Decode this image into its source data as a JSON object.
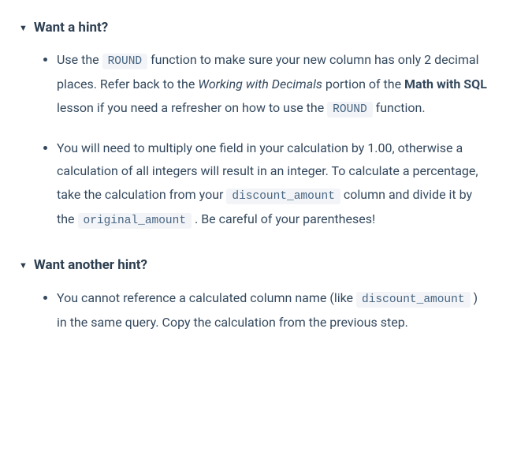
{
  "hint1": {
    "title": "Want a hint?",
    "bullet1": {
      "t1": "Use the ",
      "code1": "ROUND",
      "t2": " function to make sure your new column has only 2 decimal places. Refer back to the ",
      "italic": "Working with Decimals",
      "t3": " portion of the ",
      "bold": "Math with SQL",
      "t4": " lesson if you need a refresher on how to use the ",
      "code2": "ROUND",
      "t5": " function."
    },
    "bullet2": {
      "t1": "You will need to multiply one field in your calculation by 1.00, otherwise a calculation of all integers will result in an integer. To calculate a percentage, take the calculation from your ",
      "code1": "discount_amount",
      "t2": " column and divide it by the ",
      "code2": "original_amount",
      "t3": " . Be careful of your parentheses!"
    }
  },
  "hint2": {
    "title": "Want another hint?",
    "bullet1": {
      "t1": "You cannot reference a calculated column name (like ",
      "code1": "discount_amount",
      "t2": " ) in the same query. Copy the calculation from the previous step."
    }
  }
}
